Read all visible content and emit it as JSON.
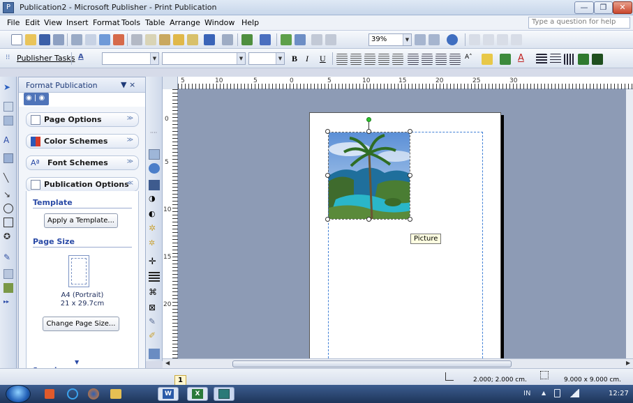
{
  "window": {
    "title": "Publication2 - Microsoft Publisher - Print Publication",
    "app_icon_glyph": "P"
  },
  "menu": {
    "items": [
      "File",
      "Edit",
      "View",
      "Insert",
      "Format",
      "Tools",
      "Table",
      "Arrange",
      "Window",
      "Help"
    ],
    "help_placeholder": "Type a question for help"
  },
  "toolbar1": {
    "zoom_value": "39%"
  },
  "toolbar2": {
    "publisher_tasks_label": "Publisher Tasks",
    "bold": "B",
    "italic": "I",
    "underline": "U"
  },
  "taskpane": {
    "title": "Format Publication",
    "close_glyph": "▼ ×",
    "nav_glyph": "◉ | ◉",
    "sections": [
      {
        "label": "Page Options",
        "icon": "page-icon"
      },
      {
        "label": "Color Schemes",
        "icon": "color-scheme-icon"
      },
      {
        "label": "Font Schemes",
        "icon": "font-scheme-icon"
      },
      {
        "label": "Publication Options",
        "icon": "publication-options-icon"
      }
    ],
    "font_scheme_glyph": "Aª",
    "template_heading": "Template",
    "apply_template_button": "Apply a Template...",
    "page_size_heading": "Page Size",
    "page_size_name": "A4 (Portrait)",
    "page_size_dims": "21 x 29.7cm",
    "change_page_size_button": "Change Page Size...",
    "see_also": "See also"
  },
  "ruler": {
    "top_labels": [
      "5",
      "10",
      "5",
      "0",
      "5",
      "10",
      "15",
      "20",
      "25",
      "30"
    ],
    "left_labels": [
      "0",
      "5",
      "10",
      "15",
      "20"
    ]
  },
  "canvas": {
    "tooltip": "Picture"
  },
  "status": {
    "page_number": "1",
    "position": "2.000; 2.000 cm.",
    "size": "9.000 x 9.000 cm."
  },
  "taskbar": {
    "tray_lang": "IN",
    "clock": "12:27"
  },
  "colors": {
    "accent": "#2a4aa6",
    "canvas_bg": "#8d9bb5",
    "taskbar_bg": "#1e355a"
  }
}
